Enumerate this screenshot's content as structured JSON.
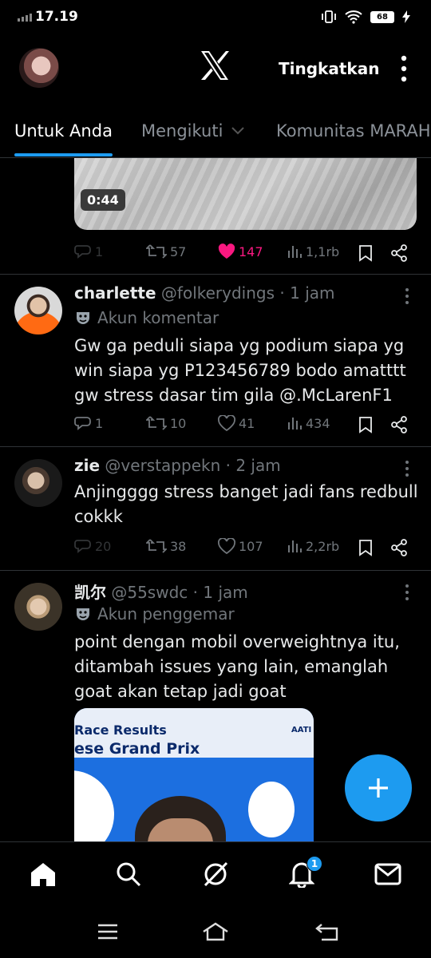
{
  "status_bar": {
    "time": "17.19",
    "battery": "68"
  },
  "header": {
    "upgrade_label": "Tingkatkan"
  },
  "tabs": [
    {
      "label": "Untuk Anda"
    },
    {
      "label": "Mengikuti"
    },
    {
      "label": "Komunitas MARAH"
    }
  ],
  "tweets": [
    {
      "media_duration": "0:44",
      "stats": {
        "replies": "1",
        "reposts": "57",
        "likes": "147",
        "views": "1,1rb"
      }
    },
    {
      "name": "charlette",
      "handle": "@folkerydings",
      "time": "· 1 jam",
      "label": "Akun komentar",
      "text": "Gw ga peduli siapa yg podium siapa yg win siapa yg P123456789 bodo amatttt gw stress dasar tim gila @.McLarenF1",
      "stats": {
        "replies": "1",
        "reposts": "10",
        "likes": "41",
        "views": "434"
      }
    },
    {
      "name": "zie",
      "handle": "@verstappekn",
      "time": "· 2 jam",
      "text": "Anjingggg stress banget jadi fans redbull cokkk",
      "stats": {
        "replies": "20",
        "reposts": "38",
        "likes": "107",
        "views": "2,2rb"
      }
    },
    {
      "name": "凯尔",
      "handle": "@55swdc",
      "time": "· 1 jam",
      "label": "Akun penggemar",
      "text": "point dengan mobil overweightnya itu, ditambah issues yang lain, emanglah goat akan tetap jadi goat",
      "media": {
        "line1": "Race Results",
        "line2": "ese Grand Prix",
        "side": "AATI"
      }
    }
  ],
  "notifications_badge": "1",
  "colors": {
    "accent": "#1d9bf0",
    "like": "#f91880",
    "muted": "#71767b",
    "divider": "#2f3336"
  },
  "icons": [
    "signal-icon",
    "vibrate-icon",
    "wifi-icon",
    "battery-icon",
    "charging-icon",
    "x-logo-icon",
    "more-vertical-icon",
    "chevron-down-icon",
    "reply-icon",
    "repost-icon",
    "heart-icon",
    "views-icon",
    "bookmark-icon",
    "share-icon",
    "theater-mask-icon",
    "plus-icon",
    "home-icon",
    "search-icon",
    "grok-icon",
    "bell-icon",
    "mail-icon",
    "menu-icon",
    "home-outline-icon",
    "back-icon"
  ]
}
